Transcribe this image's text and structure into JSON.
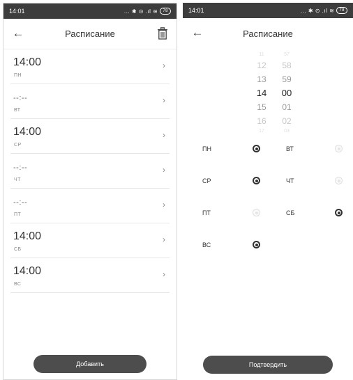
{
  "status": {
    "time": "14:01",
    "icons": "... ✱ ⊙ .ıl ≋",
    "battery": "78"
  },
  "left": {
    "title": "Расписание",
    "rows": [
      {
        "time": "14:00",
        "day": "ПН",
        "set": true
      },
      {
        "time": "--:--",
        "day": "ВТ",
        "set": false
      },
      {
        "time": "14:00",
        "day": "СР",
        "set": true
      },
      {
        "time": "--:--",
        "day": "ЧТ",
        "set": false
      },
      {
        "time": "--:--",
        "day": "ПТ",
        "set": false
      },
      {
        "time": "14:00",
        "day": "СБ",
        "set": true
      },
      {
        "time": "14:00",
        "day": "ВС",
        "set": true
      }
    ],
    "add_label": "Добавить"
  },
  "right": {
    "title": "Расписание",
    "picker": {
      "hours": [
        "11",
        "12",
        "13",
        "14",
        "15",
        "16",
        "17"
      ],
      "minutes": [
        "57",
        "58",
        "59",
        "00",
        "01",
        "02",
        "03"
      ],
      "selected_hour": "14",
      "selected_minute": "00"
    },
    "days": [
      {
        "label": "ПН",
        "checked": true
      },
      {
        "label": "ВТ",
        "checked": false
      },
      {
        "label": "СР",
        "checked": true
      },
      {
        "label": "ЧТ",
        "checked": false
      },
      {
        "label": "ПТ",
        "checked": false
      },
      {
        "label": "СБ",
        "checked": true
      },
      {
        "label": "ВС",
        "checked": true
      }
    ],
    "confirm_label": "Подтвердить"
  }
}
